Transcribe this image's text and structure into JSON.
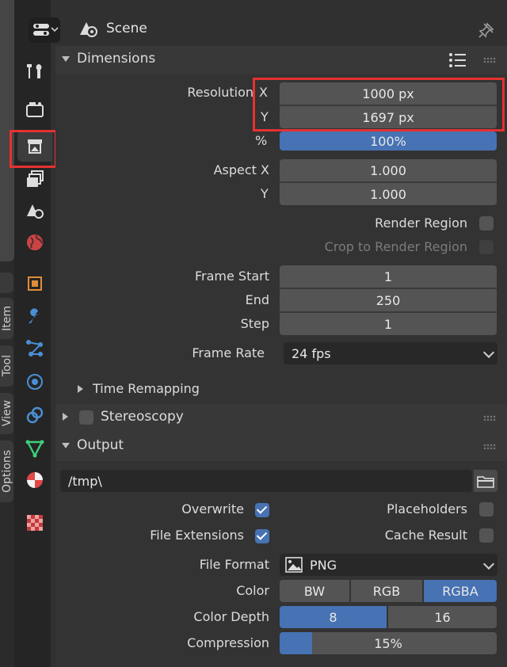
{
  "header": {
    "scene_label": "Scene"
  },
  "sidebar_tabs": [
    "tool-tab",
    "render-tab",
    "output-tab",
    "view-layer-tab",
    "scene-tab",
    "world-tab",
    "object-tab",
    "modifier-tab",
    "particles-tab",
    "physics-tab",
    "constraints-tab",
    "data-tab",
    "material-tab",
    "texture-tab"
  ],
  "n_panel_tabs": {
    "item": "Item",
    "tool": "Tool",
    "view": "View",
    "options": "Options"
  },
  "dimensions": {
    "title": "Dimensions",
    "resolution_label": "Resolution",
    "x_label": "X",
    "y_label": "Y",
    "res_x": "1000 px",
    "res_y": "1697 px",
    "percent_label": "%",
    "percent": "100%",
    "aspect_x_label": "Aspect X",
    "aspect_y_label": "Y",
    "aspect_x": "1.000",
    "aspect_y": "1.000",
    "render_region": "Render Region",
    "crop_region": "Crop to Render Region",
    "frame_start_label": "Frame Start",
    "frame_start": "1",
    "end_label": "End",
    "end": "250",
    "step_label": "Step",
    "step": "1",
    "frame_rate_label": "Frame Rate",
    "frame_rate": "24 fps",
    "time_remapping": "Time Remapping"
  },
  "stereoscopy": {
    "title": "Stereoscopy"
  },
  "output": {
    "title": "Output",
    "path": "/tmp\\",
    "overwrite": "Overwrite",
    "placeholders": "Placeholders",
    "file_extensions": "File Extensions",
    "cache_result": "Cache Result",
    "file_format_label": "File Format",
    "file_format": "PNG",
    "color_label": "Color",
    "color_options": [
      "BW",
      "RGB",
      "RGBA"
    ],
    "color_depth_label": "Color Depth",
    "color_depth_options": [
      "8",
      "16"
    ],
    "compression_label": "Compression",
    "compression": "15%",
    "compression_fraction": 0.15
  },
  "colors": {
    "accent": "#4772b3",
    "highlight": "#e63131"
  }
}
